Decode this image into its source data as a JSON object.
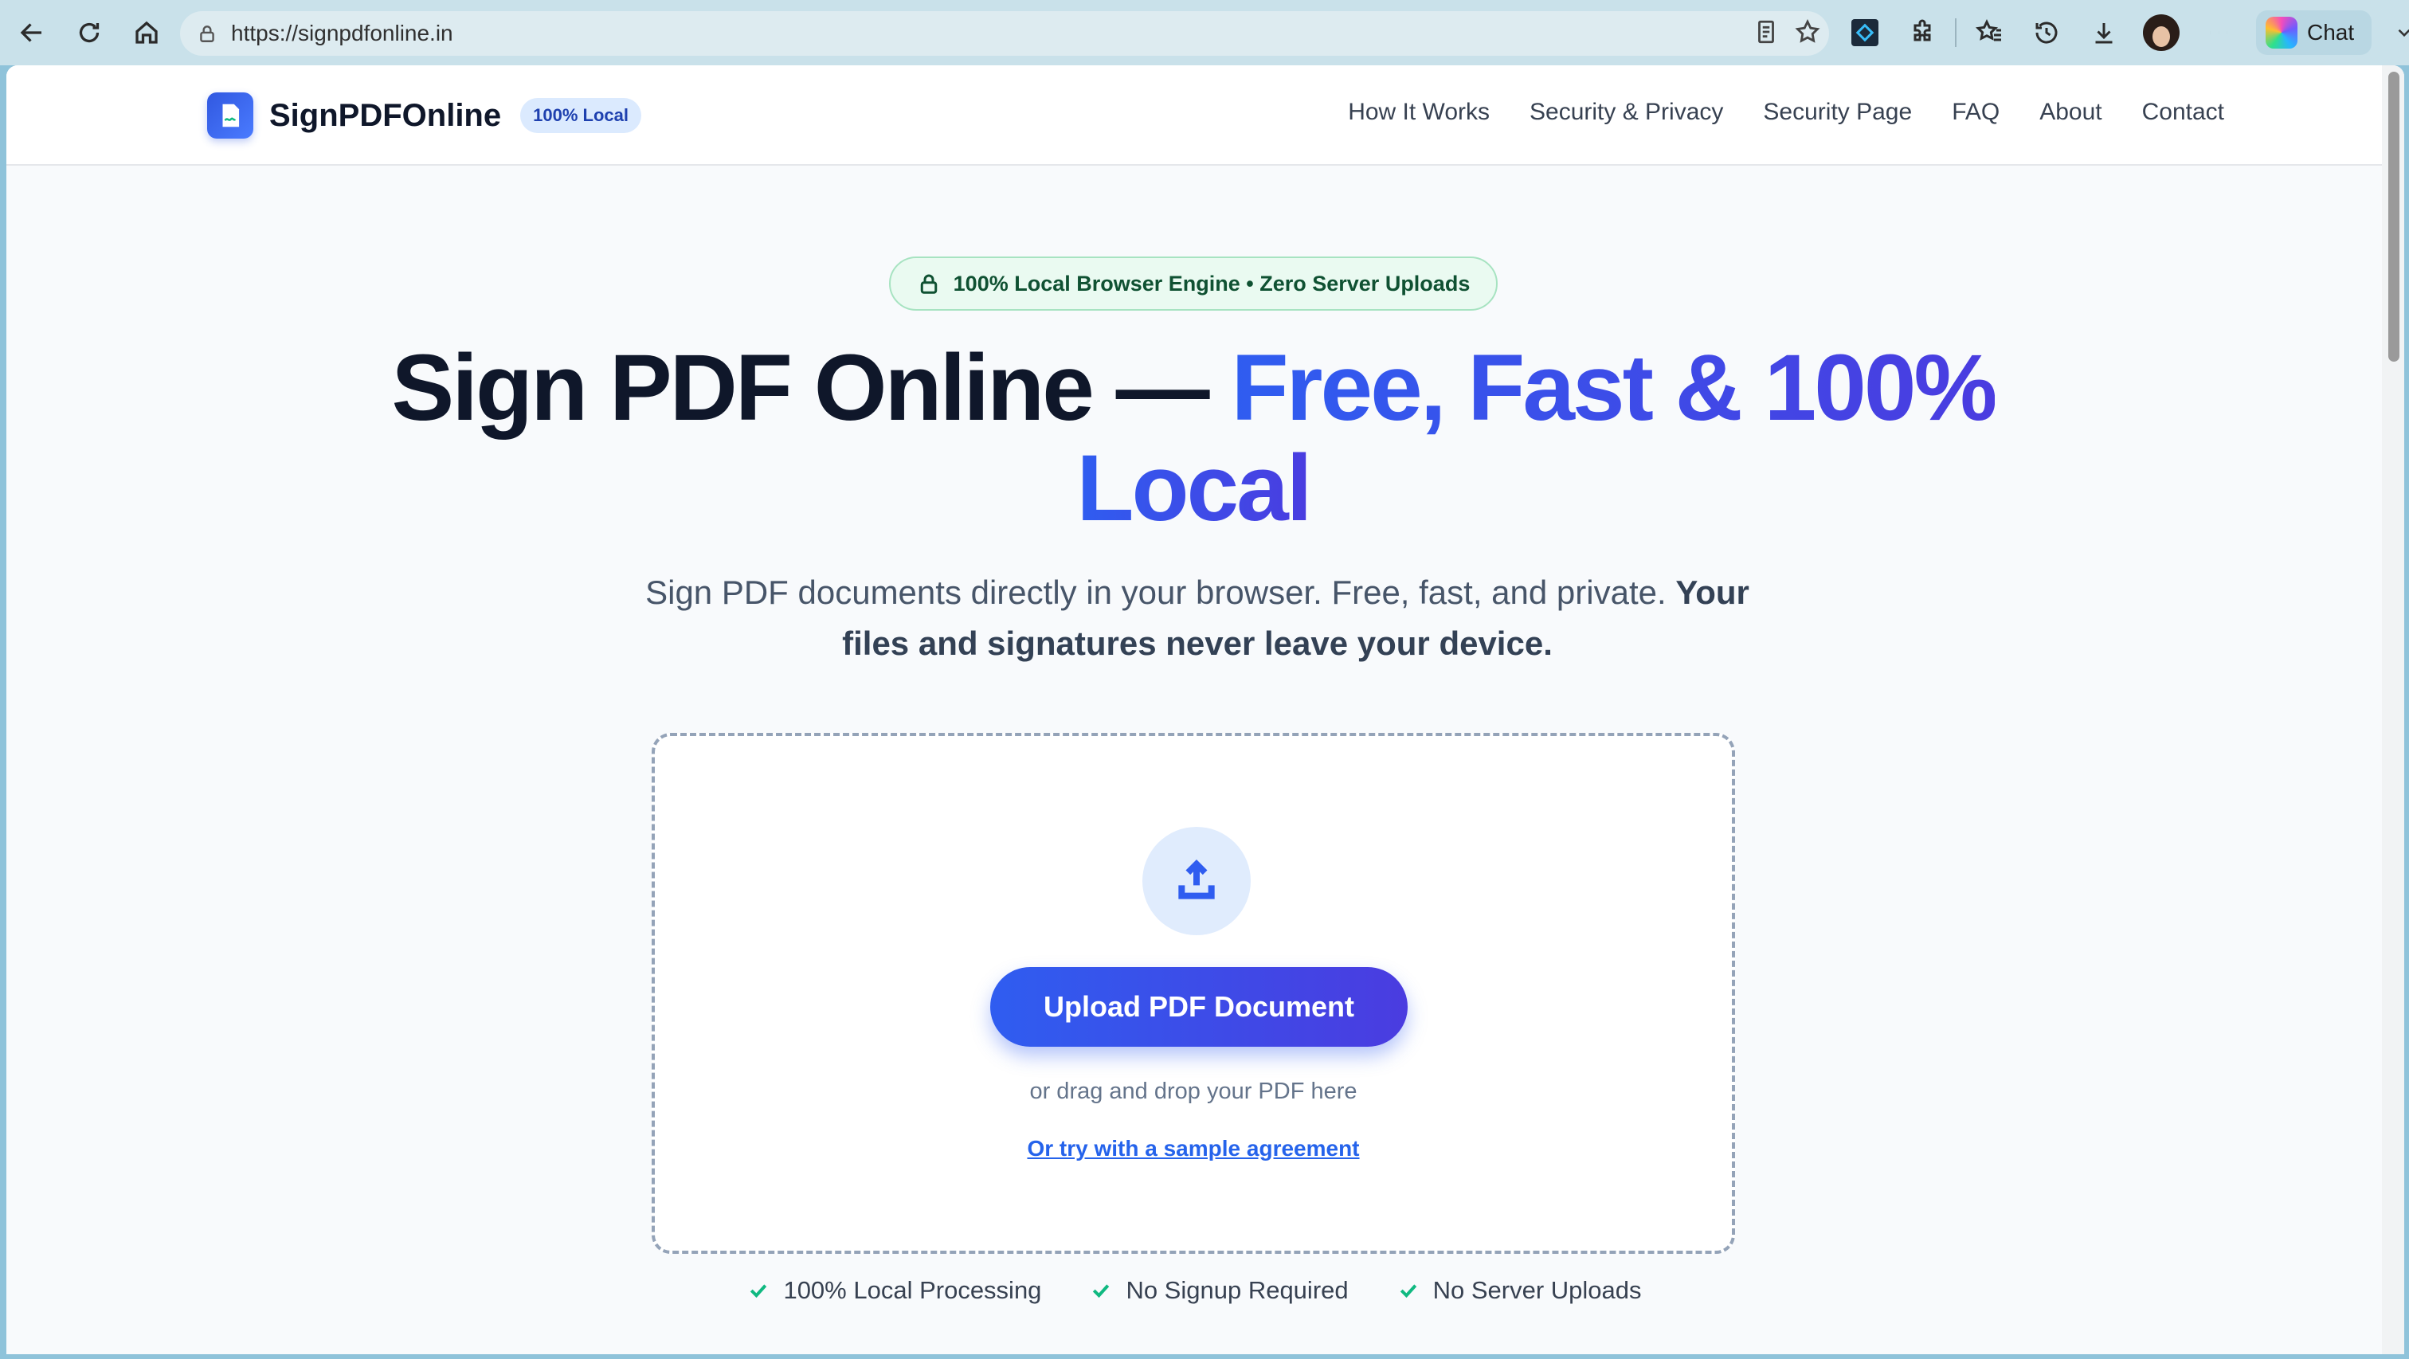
{
  "browser": {
    "url": "https://signpdfonline.in",
    "chat_label": "Chat"
  },
  "site": {
    "brand_name": "SignPDFOnline",
    "brand_badge": "100% Local",
    "nav": [
      {
        "label": "How It Works"
      },
      {
        "label": "Security & Privacy"
      },
      {
        "label": "Security Page"
      },
      {
        "label": "FAQ"
      },
      {
        "label": "About"
      },
      {
        "label": "Contact"
      }
    ]
  },
  "hero": {
    "badge": "100% Local Browser Engine • Zero Server Uploads",
    "title_dark": "Sign PDF Online — ",
    "title_accent_1": "Free, Fast & 100%",
    "title_accent_2": "Local",
    "subtitle_plain": "Sign PDF documents directly in your browser. Free, fast, and private. ",
    "subtitle_bold": "Your files and signatures never leave your device."
  },
  "upload": {
    "button_label": "Upload PDF Document",
    "drag_text": "or drag and drop your PDF here",
    "sample_link": "Or try with a sample agreement"
  },
  "features": [
    {
      "label": "100% Local Processing"
    },
    {
      "label": "No Signup Required"
    },
    {
      "label": "No Server Uploads"
    }
  ],
  "colors": {
    "accent": "#2f5df0",
    "accent_2": "#4a3ce0",
    "success": "#10b981",
    "badge_green_bg": "#eafaf1"
  }
}
